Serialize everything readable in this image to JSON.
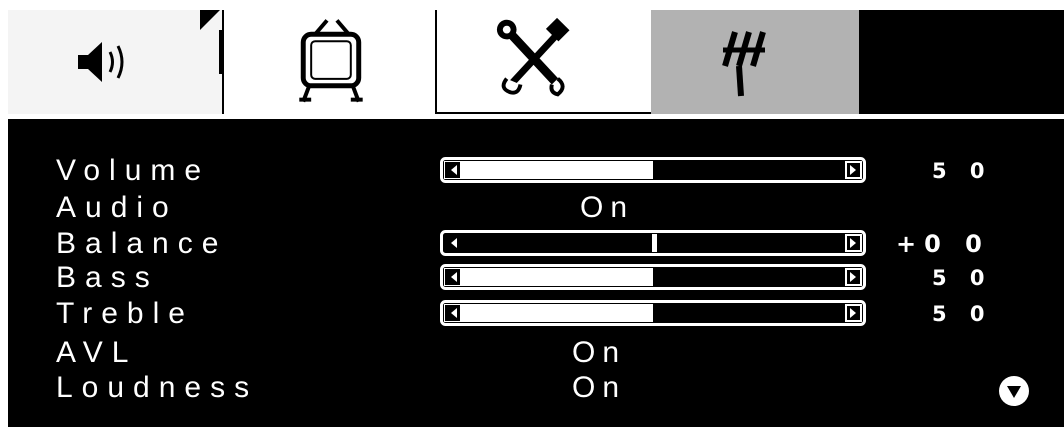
{
  "tabs": [
    {
      "id": "audio",
      "icon": "speaker-icon",
      "active": true
    },
    {
      "id": "picture",
      "icon": "tv-icon",
      "active": false
    },
    {
      "id": "setup",
      "icon": "tools-icon",
      "active": false
    },
    {
      "id": "channel",
      "icon": "channel-tune-icon",
      "active": false
    }
  ],
  "menu": {
    "volume": {
      "label": "Volume",
      "value": "5 0",
      "level": 0.5
    },
    "audio": {
      "label": "Audio",
      "state": "On"
    },
    "balance": {
      "label": "Balance",
      "value": "+0 0",
      "level": 0.5
    },
    "bass": {
      "label": "Bass",
      "value": "5 0",
      "level": 0.5
    },
    "treble": {
      "label": "Treble",
      "value": "5 0",
      "level": 0.5
    },
    "avl": {
      "label": "AVL",
      "state": "On"
    },
    "loudness": {
      "label": "Loudness",
      "state": "On"
    }
  },
  "scroll_icon": "scroll-down-icon",
  "colors": {
    "panel": "#000000",
    "text": "#ffffff",
    "tab_selected": "#f4f4f4",
    "tab_normal": "#ffffff",
    "tab_highlight": "#b2b2b2"
  }
}
